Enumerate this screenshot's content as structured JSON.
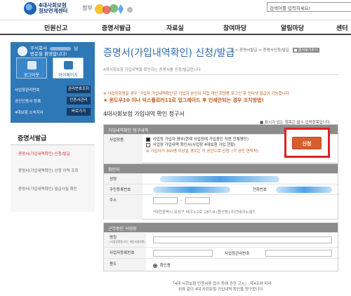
{
  "header": {
    "logo_line1": "4대사회보험",
    "logo_line2": "정보연계센터",
    "gov_label": "정부",
    "search_placeholder": "검색어를 입력하세요!"
  },
  "gnb": [
    "민원신고",
    "증명서발급",
    "자료실",
    "참여마당",
    "알림마당",
    "센터"
  ],
  "login_box": {
    "greeting_line1": "주식회사",
    "greeting_line2": "님",
    "greeting_line3": "방문을 환영합니다!",
    "logout_label": "로그아웃",
    "mypage_label": "마이페이지",
    "rows": [
      {
        "text": "사업장관리번호",
        "button": "관리번호조회"
      },
      {
        "text": "공인인증서 등록",
        "button": "인증서관리"
      },
      {
        "text": "4대보험 소속지사",
        "button": "바로가기"
      }
    ]
  },
  "snb": {
    "title": "증명서발급",
    "items": [
      "증명서(가입내역확인) 신청/발급",
      "증명서(가입내역확인) 신청 이력 조회",
      "증명서(가입내역확인) 발급사실 확인"
    ]
  },
  "main": {
    "title": "증명서(가입내역확인) 신청/발급",
    "breadcrumb": "홈 > 증명서발급 > 증명서신청/발급",
    "breadcrumb_badge": "■ 즐겨찾기추가",
    "desc": "4대사회보험 가입내역을 확인하는 증명서를 신청/발급합니다.",
    "notice1": "※ 사업장회원일 경우 '가입자 가입내역확인'은 가입자 본인이 직접 개인 회원용 로그인 후 인터넷 발급이 가능합니다.",
    "notice2": "★ 윈도우10 이나 익스플로러11로 업그레이드 후 인쇄안되는 경우 조치방법!",
    "form_title": "4대사회보험 가입내역 확인 청구서",
    "required_note": "■ 표시가 있는 항목은 필수 입력항목입니다.",
    "section1_title": "가입내역확인 청구내역",
    "section1_label": "사업장용",
    "option1": "사업장 가입자 명부(현재 사업장에 가입중인 직원 전체명단)",
    "option2": "사업장 가입내역 확인서(사업장 4대보험 가입 현황)",
    "option_note": "※ 가입자가 300명 이상일 경우는 각 공단으로 신청. (각 공단 연락처)",
    "apply_label": "신청",
    "section2_title": "확인자",
    "name_label": "성명",
    "id_label": "주민등록번호",
    "phone_label": "전화번호",
    "address_label": "주소",
    "address_value": "*대전광역시 유성구 테크노2로 187-9 (용산동) 미건테크노월드",
    "section3_title": "근무중인 사업장",
    "bizname_label": "명칭",
    "bizname_sub": "(사업장명칭 또는 개인사업자명)",
    "biznum_label": "사업자등록번호",
    "mgmt_label": "사업장관리번호",
    "purpose_label": "용도",
    "purpose_value": "확인용",
    "footnote_line1": "「4대 사회보험 민원서류 접수 등에 관한 고시」 제4조에 따라",
    "footnote_line2": "위와 같이 4대 사회보험 가입내역 확인을 청구합니다."
  },
  "colors": {
    "accent_blue": "#2f78b7",
    "highlight_red": "#e11f26",
    "apply_orange": "#d75d2c"
  }
}
